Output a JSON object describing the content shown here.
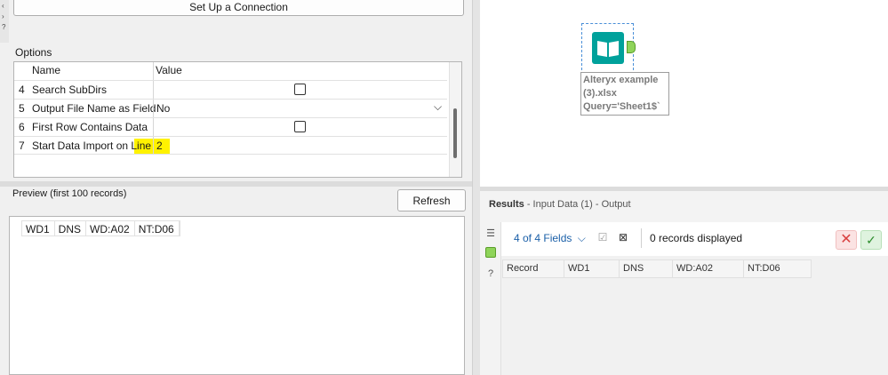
{
  "config": {
    "setup_button": "Set Up a Connection",
    "options_label": "Options",
    "columns": {
      "name": "Name",
      "value": "Value"
    },
    "rows": [
      {
        "num": "4",
        "name": "Search SubDirs",
        "type": "checkbox",
        "checked": false
      },
      {
        "num": "5",
        "name": "Output File Name as Field",
        "type": "dropdown",
        "value": "No"
      },
      {
        "num": "6",
        "name": "First Row Contains Data",
        "type": "checkbox",
        "checked": false
      },
      {
        "num": "7",
        "name": "Start Data Import on Line",
        "type": "text",
        "value": "2"
      }
    ],
    "highlight_color": "#fff200"
  },
  "preview": {
    "title": "Preview (first 100 records)",
    "refresh_label": "Refresh",
    "columns": [
      "WD1",
      "DNS",
      "WD:A02",
      "NT:D06"
    ]
  },
  "canvas": {
    "tool": {
      "icon": "book-icon",
      "label_lines": [
        "Alteryx example",
        "(3).xlsx",
        "Query='Sheet1$`"
      ],
      "icon_color": "#00a19b",
      "anchor_color": "#8fd45a"
    }
  },
  "results": {
    "title": "Results",
    "subtitle": "- Input Data (1) - Output",
    "fields_selector": "4 of 4 Fields",
    "records_text": "0 records displayed",
    "columns": [
      "Record",
      "WD1",
      "DNS",
      "WD:A02",
      "NT:D06"
    ],
    "side_icons": [
      "list-icon",
      "output-anchor-icon",
      "help-icon"
    ],
    "cancel_glyph": "✕",
    "accept_glyph": "✓"
  }
}
